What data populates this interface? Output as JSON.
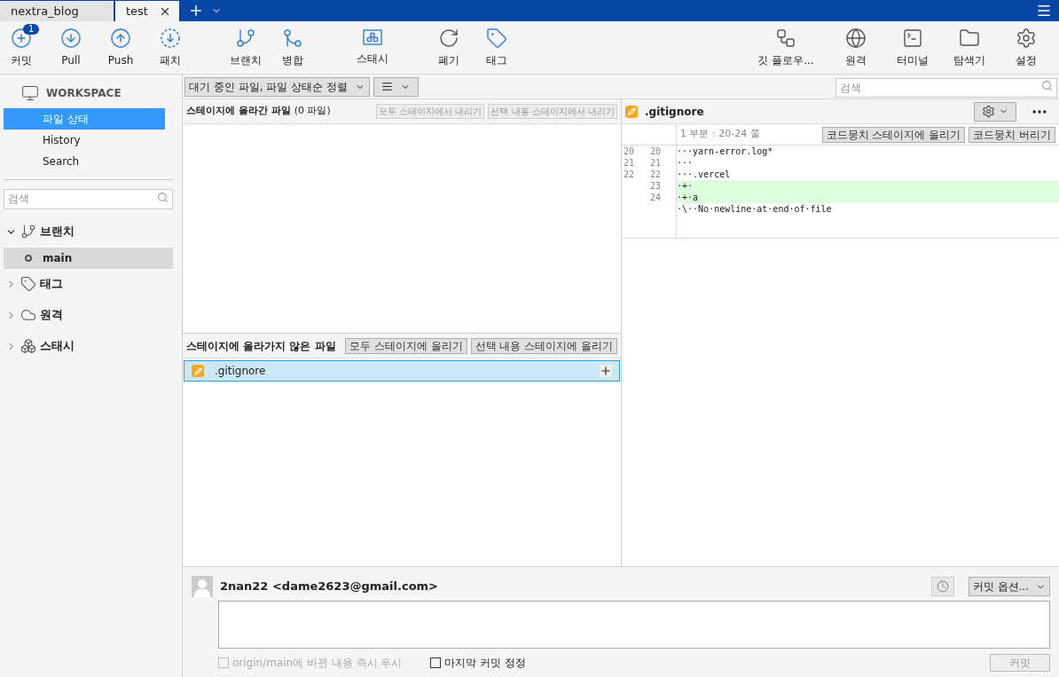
{
  "tabs": [
    {
      "label": "nextra_blog",
      "selected": false
    },
    {
      "label": "test",
      "selected": true
    }
  ],
  "toolbar_left": [
    {
      "kind": "commit",
      "label": "커밋",
      "badge": "1"
    },
    {
      "kind": "pull",
      "label": "Pull"
    },
    {
      "kind": "push",
      "label": "Push"
    },
    {
      "kind": "fetch",
      "label": "패치"
    },
    {
      "kind": "branch",
      "label": "브랜치"
    },
    {
      "kind": "merge",
      "label": "병합"
    },
    {
      "kind": "stash",
      "label": "스태시"
    },
    {
      "kind": "discard",
      "label": "폐기"
    },
    {
      "kind": "tag",
      "label": "태그"
    }
  ],
  "toolbar_right": [
    {
      "kind": "flow",
      "label": "깃 플로우..."
    },
    {
      "kind": "remote",
      "label": "원격"
    },
    {
      "kind": "terminal",
      "label": "터미널"
    },
    {
      "kind": "explorer",
      "label": "탐색기"
    },
    {
      "kind": "settings",
      "label": "설정"
    }
  ],
  "sidebar": {
    "workspace": "WORKSPACE",
    "items": [
      {
        "label": "파일 상태",
        "selected": true
      },
      {
        "label": "History",
        "selected": false
      },
      {
        "label": "Search",
        "selected": false
      }
    ],
    "search": {
      "placeholder": "검색"
    },
    "sections": [
      {
        "kind": "branch",
        "label": "브랜치",
        "expanded": true,
        "children": [
          {
            "label": "main",
            "selected": true
          }
        ]
      },
      {
        "kind": "tag",
        "label": "태그",
        "expanded": false
      },
      {
        "kind": "remote",
        "label": "원격",
        "expanded": false
      },
      {
        "kind": "stash",
        "label": "스태시",
        "expanded": false
      }
    ]
  },
  "filter": {
    "sort": "대기 중인 파일, 파일 상태순 정렬",
    "search_placeholder": "검색"
  },
  "staged": {
    "title": "스테이지에 올라간 파일",
    "count": "(0 파일)",
    "buttons": [
      "모두 스테이지에서 내리기",
      "선택 내용 스테이지에서 내리기"
    ]
  },
  "unstaged": {
    "title": "스테이지에 올라가지 않은 파일",
    "buttons": [
      "모두 스테이지에 올리기",
      "선택 내용 스테이지에 올리기"
    ],
    "files": [
      {
        "name": ".gitignore",
        "selected": true
      }
    ]
  },
  "diff": {
    "file": ".gitignore",
    "hunk": "1 부분 : 20-24 쭐",
    "buttons": [
      "코드뭉치 스테이지에 올리기",
      "코드뭉치 버리기"
    ],
    "lines": [
      {
        "old": "20",
        "new": "20",
        "text": "···yarn-error.log*",
        "kind": "context"
      },
      {
        "old": "21",
        "new": "21",
        "text": "···",
        "kind": "context"
      },
      {
        "old": "22",
        "new": "22",
        "text": "···.vercel",
        "kind": "context"
      },
      {
        "new": "23",
        "text": "·+·",
        "kind": "added"
      },
      {
        "new": "24",
        "text": "·+·a",
        "kind": "added"
      },
      {
        "text": "·\\··No·newline·at·end·of·file",
        "kind": "context"
      }
    ]
  },
  "commit": {
    "author": "2nan22 <dame2623@gmail.com>",
    "options": "커밋 옵션...",
    "push": {
      "label": "origin/main에 바뀐 내용 즉시 푸시",
      "checked": false,
      "disabled": true
    },
    "amend": {
      "label": "마지막 커밋 정정",
      "checked": false
    },
    "button": {
      "label": "커밋",
      "disabled": true
    }
  }
}
